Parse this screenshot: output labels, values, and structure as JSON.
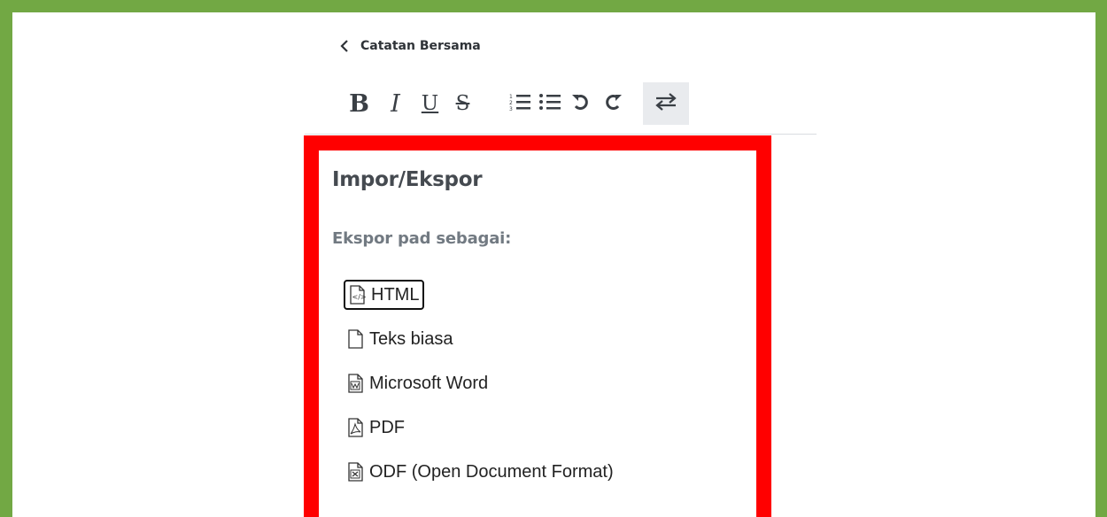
{
  "header": {
    "back_label": "Catatan Bersama"
  },
  "toolbar": {
    "bold": "B",
    "italic": "I",
    "underline": "U",
    "strikethrough": "S"
  },
  "popup": {
    "title": "Impor/Ekspor",
    "subtitle": "Ekspor pad sebagai:",
    "export_options": [
      {
        "label": "HTML",
        "icon": "html-file-icon"
      },
      {
        "label": "Teks biasa",
        "icon": "text-file-icon"
      },
      {
        "label": "Microsoft Word",
        "icon": "word-file-icon"
      },
      {
        "label": "PDF",
        "icon": "pdf-file-icon"
      },
      {
        "label": "ODF (Open Document Format)",
        "icon": "odf-file-icon"
      }
    ]
  },
  "colors": {
    "frame_border": "#72a844",
    "highlight_box": "#ff0000",
    "toolbar_active_bg": "#e9ebee"
  }
}
